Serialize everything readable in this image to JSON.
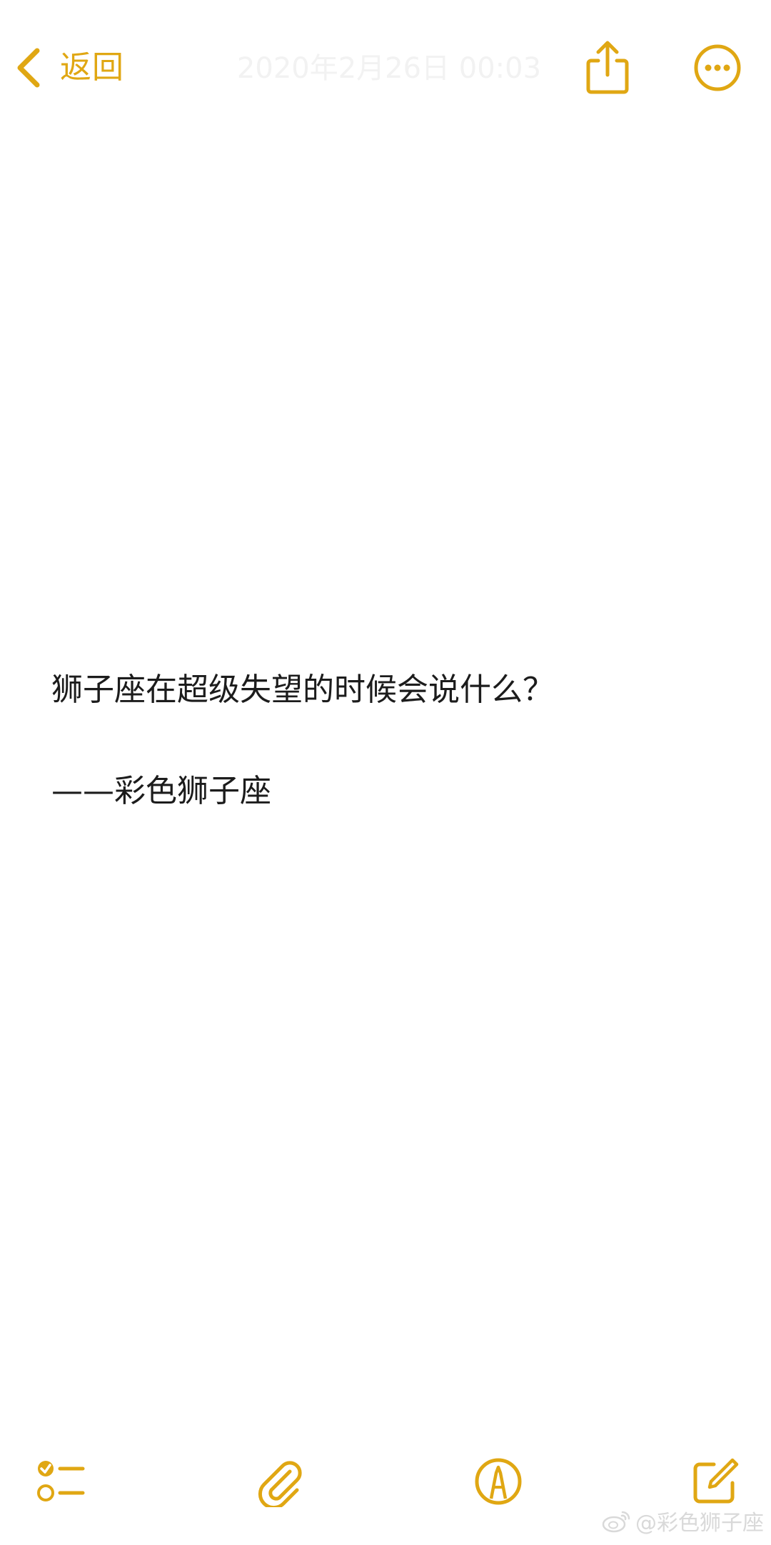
{
  "header": {
    "back_label": "返回",
    "date_title": "2020年2月26日 00:03"
  },
  "note": {
    "lines": [
      "狮子座在超级失望的时候会说什么？",
      "——彩色狮子座"
    ]
  },
  "toolbar": {
    "icons": [
      "checklist-icon",
      "paperclip-icon",
      "markup-pen-icon",
      "compose-icon"
    ]
  },
  "watermark": {
    "text": "@彩色狮子座"
  },
  "colors": {
    "accent": "#E0A713",
    "text": "#1c1c1c",
    "background": "#ffffff"
  }
}
